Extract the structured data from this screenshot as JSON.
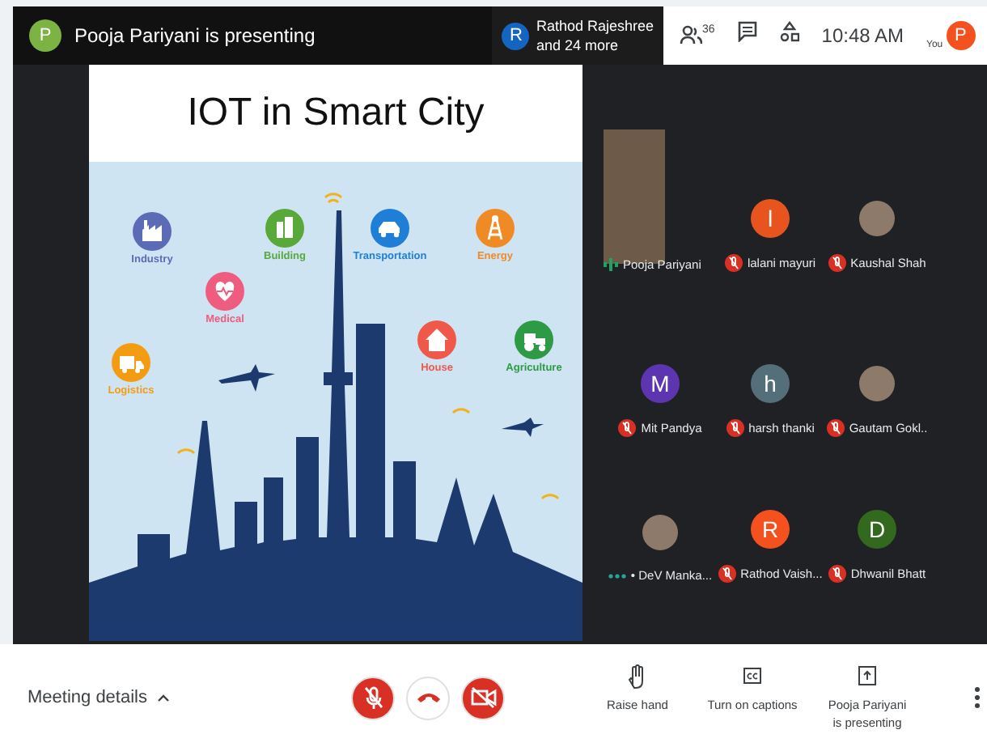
{
  "top_bar": {
    "presenter_avatar": "P",
    "presenter_text": "Pooja Pariyani is presenting",
    "chip_avatar": "R",
    "chip_line1": "Rathod Rajeshree",
    "chip_line2": "and 24 more",
    "people_count": "36",
    "time": "10:48 AM",
    "you_label": "You",
    "you_avatar": "P"
  },
  "slide": {
    "title": "IOT in Smart City",
    "categories": [
      {
        "label": "Industry",
        "color": "#5b6bb5"
      },
      {
        "label": "Medical",
        "color": "#ee5d7f"
      },
      {
        "label": "Building",
        "color": "#58a83a"
      },
      {
        "label": "Transportation",
        "color": "#1f7fd6"
      },
      {
        "label": "Energy",
        "color": "#f08a24"
      },
      {
        "label": "Logistics",
        "color": "#f39c12"
      },
      {
        "label": "House",
        "color": "#f0584a"
      },
      {
        "label": "Agriculture",
        "color": "#2e9a45"
      }
    ]
  },
  "participants": [
    {
      "name": "Pooja Pariyani",
      "kind": "video",
      "muted": false,
      "talking": true
    },
    {
      "name": "lalani mayuri",
      "kind": "letter",
      "letter": "l",
      "color": "#e8541e",
      "muted": true
    },
    {
      "name": "Kaushal Shah",
      "kind": "photo",
      "muted": true
    },
    {
      "name": "Mit Pandya",
      "kind": "letter",
      "letter": "M",
      "color": "#5e35b1",
      "muted": true
    },
    {
      "name": "harsh thanki",
      "kind": "letter",
      "letter": "h",
      "color": "#546e7a",
      "muted": true
    },
    {
      "name": "Gautam Gokl..",
      "kind": "photo",
      "muted": true
    },
    {
      "name": "• DeV Manka...",
      "kind": "photo",
      "muted": false,
      "talking": false
    },
    {
      "name": "Rathod Vaish...",
      "kind": "letter",
      "letter": "R",
      "color": "#f4511e",
      "muted": true
    },
    {
      "name": "Dhwanil Bhatt",
      "kind": "letter",
      "letter": "D",
      "color": "#33691e",
      "muted": true
    }
  ],
  "bottom_bar": {
    "meeting_details": "Meeting details",
    "controls": [
      {
        "kind": "mic",
        "on": false
      },
      {
        "kind": "hangup",
        "on": true
      },
      {
        "kind": "camera",
        "on": false
      }
    ],
    "actions": [
      {
        "kind": "hand",
        "label": "Raise hand"
      },
      {
        "kind": "captions",
        "label": "Turn on captions"
      },
      {
        "kind": "present",
        "label": "Pooja Pariyani is presenting"
      }
    ]
  }
}
